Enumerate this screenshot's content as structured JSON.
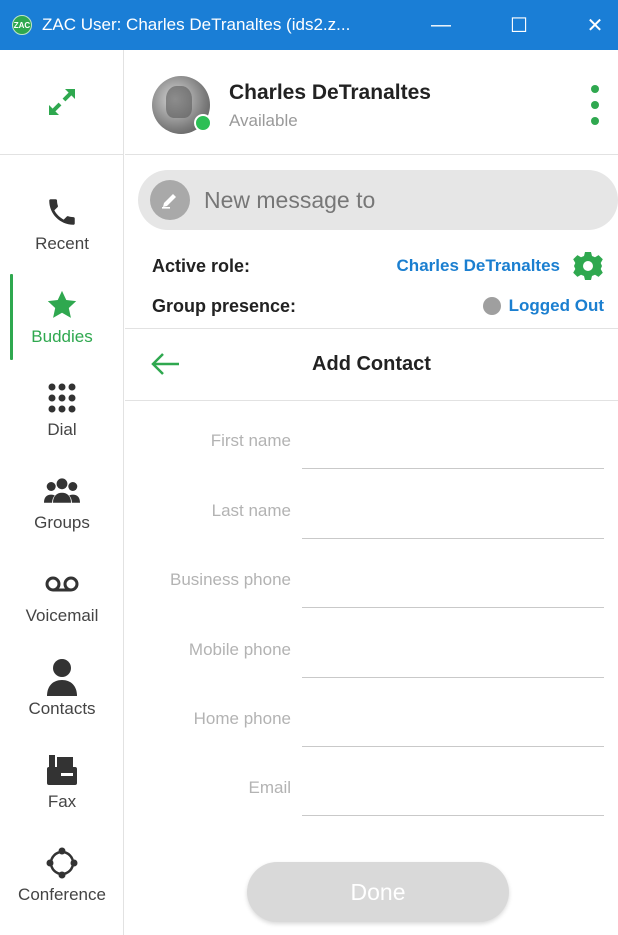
{
  "window": {
    "title": "ZAC User: Charles DeTranaltes (ids2.z...",
    "app_icon_text": "ZAC",
    "minimize": "—",
    "maximize": "☐",
    "close": "✕"
  },
  "sidebar": {
    "items": [
      {
        "label": "Recent",
        "icon": "phone-icon",
        "active": false
      },
      {
        "label": "Buddies",
        "icon": "star-icon",
        "active": true
      },
      {
        "label": "Dial",
        "icon": "dialpad-icon",
        "active": false
      },
      {
        "label": "Groups",
        "icon": "group-icon",
        "active": false
      },
      {
        "label": "Voicemail",
        "icon": "voicemail-icon",
        "active": false
      },
      {
        "label": "Contacts",
        "icon": "contact-icon",
        "active": false
      },
      {
        "label": "Fax",
        "icon": "fax-icon",
        "active": false
      },
      {
        "label": "Conference",
        "icon": "conference-icon",
        "active": false
      }
    ],
    "accent": "#2fa84f"
  },
  "profile": {
    "name": "Charles DeTranaltes",
    "status": "Available",
    "status_color": "#2cbf55"
  },
  "message": {
    "placeholder": "New message to"
  },
  "role": {
    "label": "Active role:",
    "value": "Charles DeTranaltes"
  },
  "group_presence": {
    "label": "Group presence:",
    "value": "Logged Out"
  },
  "add_contact": {
    "title": "Add Contact",
    "fields": [
      {
        "label": "First name",
        "value": ""
      },
      {
        "label": "Last name",
        "value": ""
      },
      {
        "label": "Business phone",
        "value": ""
      },
      {
        "label": "Mobile phone",
        "value": ""
      },
      {
        "label": "Home phone",
        "value": ""
      },
      {
        "label": "Email",
        "value": ""
      }
    ],
    "done_label": "Done"
  },
  "colors": {
    "titlebar": "#1a7ed6",
    "link": "#1b7fd0",
    "accent": "#2fa84f"
  }
}
